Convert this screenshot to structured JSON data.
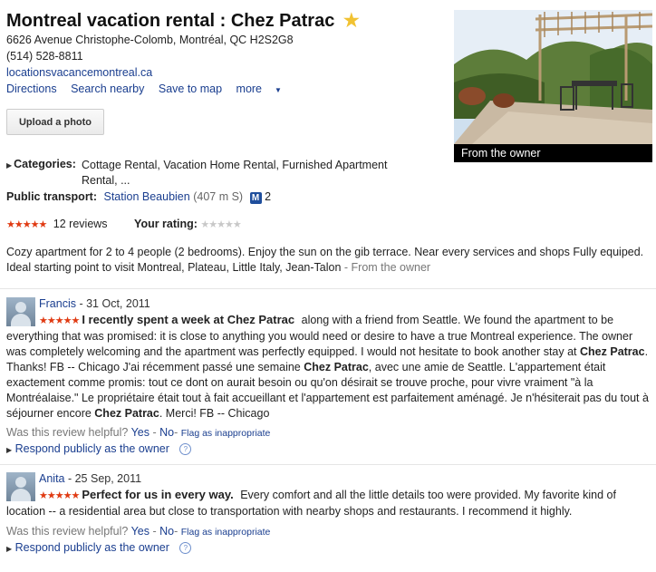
{
  "place": {
    "title": "Montreal vacation rental : Chez Patrac",
    "address": "6626 Avenue Christophe-Colomb, Montréal, QC H2S2G8",
    "phone": "(514) 528-8811",
    "website": "locationsvacancemontreal.ca"
  },
  "actions": {
    "directions": "Directions",
    "search_nearby": "Search nearby",
    "save_to_map": "Save to map",
    "more": "more"
  },
  "upload_label": "Upload a photo",
  "photo_caption": "From the owner",
  "categories": {
    "label": "Categories:",
    "values": "Cottage Rental, Vacation Home Rental, Furnished Apartment Rental, ..."
  },
  "transport": {
    "label": "Public transport:",
    "station": "Station Beaubien",
    "distance": "(407 m S)",
    "metro_letter": "M",
    "line": "2"
  },
  "rating": {
    "stars": "★★★★★",
    "reviews": "12 reviews",
    "your_rating_label": "Your rating:",
    "your_rating_stars": "★★★★★"
  },
  "description": {
    "text": "Cozy apartment for 2 to 4 people (2 bedrooms). Enjoy the sun on the gib terrace. Near every services and shops Fully equiped. Ideal starting point to visit Montreal, Plateau, Little Italy, Jean-Talon",
    "source": " - From the owner"
  },
  "reviews": [
    {
      "author": "Francis",
      "date": " - 31 Oct, 2011",
      "stars": "★★★★★",
      "headline": "I recently spent a week at Chez Patrac",
      "body_1": "along with a friend from Seattle. We found the apartment to be everything that was promised: it is close to anything you would need or desire to have a true Montreal experience. The owner was completely welcoming and the apartment was perfectly equipped. I would not hesitate to book another stay at ",
      "bold_1": "Chez Patrac",
      "body_2": ". Thanks! FB -- Chicago J'ai récemment passé une semaine ",
      "bold_2": "Chez Patrac",
      "body_3": ", avec une amie de Seattle. L'appartement était exactement comme promis: tout ce dont on aurait besoin ou qu'on désirait se trouve proche, pour vivre vraiment \"à la Montréalaise.\" Le propriétaire était tout à fait accueillant et l'appartement est parfaitement aménagé. Je n'hésiterait pas du tout à séjourner encore ",
      "bold_3": "Chez Patrac",
      "body_4": ". Merci! FB -- Chicago"
    },
    {
      "author": "Anita",
      "date": " - 25 Sep, 2011",
      "stars": "★★★★★",
      "headline": "Perfect for us in every way.",
      "body_1": "Every comfort and all the little details too were provided. My favorite kind of location -- a residential area but close to transportation with nearby shops and restaurants. I recommend it highly."
    }
  ],
  "helpful": {
    "question": "Was this review helpful?",
    "yes": "Yes",
    "sep": " - ",
    "no": "No",
    "dash": "-",
    "flag": "Flag as inappropriate"
  },
  "respond_label": "Respond publicly as the owner",
  "help_glyph": "?",
  "colors": {
    "link": "#1a3e8f",
    "star_red": "#e03a12",
    "star_gold": "#f1c232",
    "metro_blue": "#1f4e9c"
  }
}
